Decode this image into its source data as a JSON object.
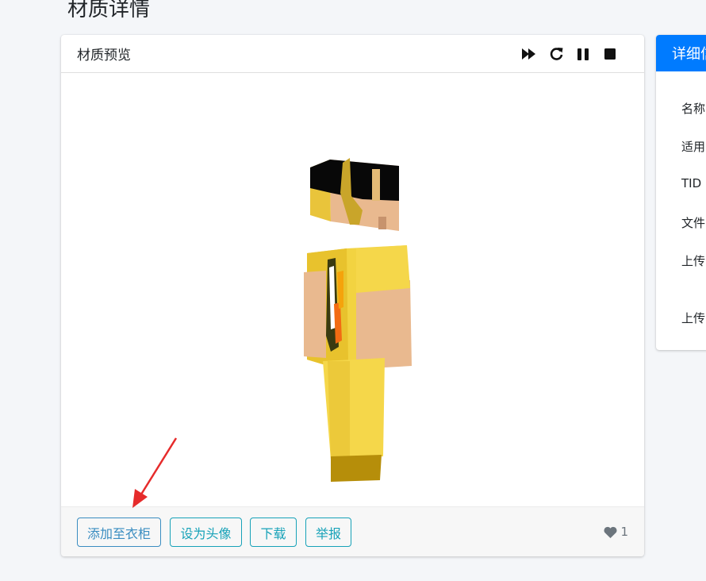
{
  "page": {
    "title": "材质详情"
  },
  "preview": {
    "title": "材质预览",
    "tools": [
      {
        "name": "fast-forward-icon"
      },
      {
        "name": "rotate-icon"
      },
      {
        "name": "pause-icon"
      },
      {
        "name": "stop-icon"
      }
    ]
  },
  "actions": {
    "add_to_closet": "添加至衣柜",
    "set_avatar": "设为头像",
    "download": "下载",
    "report": "举报"
  },
  "likes": {
    "count": "1"
  },
  "details": {
    "header": "详细信",
    "rows": [
      "名称",
      "适用",
      "TID",
      "文件",
      "上传",
      "上传"
    ]
  },
  "colors": {
    "accent": "#007bff",
    "info": "#17a2b8",
    "annotation_arrow": "#e62b2b"
  }
}
